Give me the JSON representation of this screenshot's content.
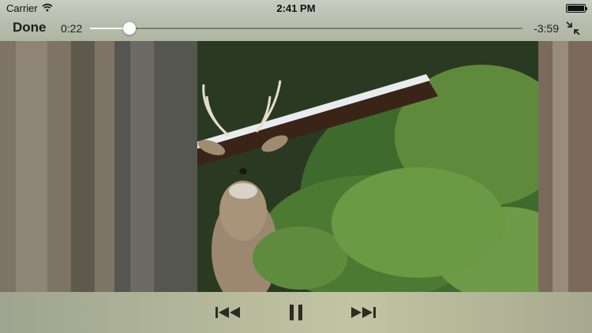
{
  "status_bar": {
    "carrier": "Carrier",
    "time": "2:41 PM",
    "wifi_icon": "wifi-icon",
    "battery_icon": "battery-icon"
  },
  "player": {
    "done_label": "Done",
    "elapsed": "0:22",
    "remaining": "-3:59",
    "progress_fraction": 0.092,
    "exit_fullscreen_icon": "exit-fullscreen-icon"
  },
  "transport": {
    "previous_icon": "skip-back-icon",
    "pause_icon": "pause-icon",
    "next_icon": "skip-forward-icon"
  },
  "colors": {
    "chrome_top": "#b9bfb0",
    "chrome_bottom": "#b7bb9c",
    "icon_dark": "#2b2d22",
    "track_played": "#ffffff"
  }
}
